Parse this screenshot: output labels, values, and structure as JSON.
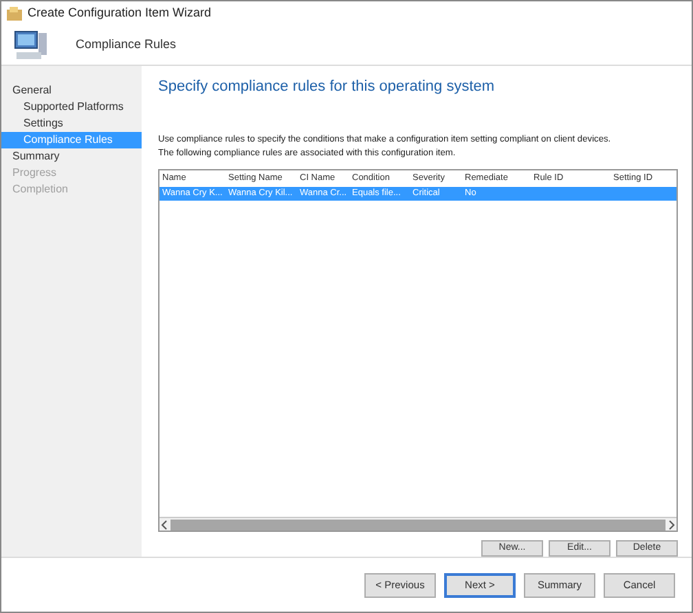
{
  "window": {
    "title": "Create Configuration Item Wizard"
  },
  "header": {
    "title": "Compliance Rules"
  },
  "nav": [
    {
      "label": "General",
      "selected": false,
      "disabled": false,
      "children": [
        {
          "label": "Supported Platforms",
          "selected": false,
          "disabled": false
        },
        {
          "label": "Settings",
          "selected": false,
          "disabled": false
        },
        {
          "label": "Compliance Rules",
          "selected": true,
          "disabled": false
        }
      ]
    },
    {
      "label": "Summary",
      "selected": false,
      "disabled": false
    },
    {
      "label": "Progress",
      "selected": false,
      "disabled": true
    },
    {
      "label": "Completion",
      "selected": false,
      "disabled": true
    }
  ],
  "page": {
    "heading": "Specify compliance rules for this operating system",
    "description": [
      "Use compliance rules to specify the conditions that make a configuration item setting compliant on client devices.",
      "The following compliance rules are associated with this configuration item."
    ]
  },
  "table": {
    "columns": [
      "Name",
      "Setting Name",
      "CI Name",
      "Condition",
      "Severity",
      "Remediate",
      "Rule ID",
      "Setting ID"
    ],
    "rows": [
      {
        "cells": [
          "Wanna Cry K...",
          "Wanna Cry Kil...",
          "Wanna Cr...",
          "Equals file...",
          "Critical",
          "No",
          "",
          ""
        ],
        "selected": true
      }
    ]
  },
  "table_buttons": [
    "New...",
    "Edit...",
    "Delete"
  ],
  "footer_buttons": [
    {
      "label": "< Previous",
      "focused": false
    },
    {
      "label": "Next >",
      "focused": true
    },
    {
      "label": "Summary",
      "focused": false
    },
    {
      "label": "Cancel",
      "focused": false
    }
  ]
}
